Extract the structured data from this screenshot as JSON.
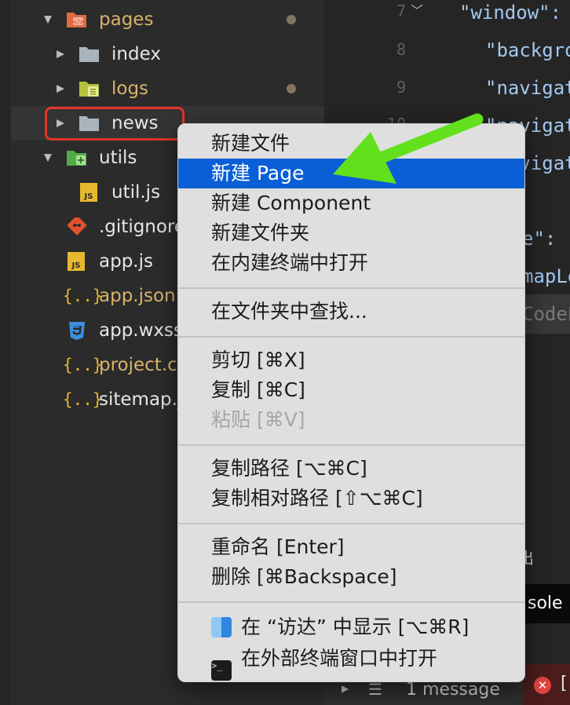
{
  "explorer": {
    "items": [
      {
        "label": "pages",
        "type": "folder-open",
        "color": "#e06a43"
      },
      {
        "label": "index",
        "type": "folder"
      },
      {
        "label": "logs",
        "type": "folder-logs"
      },
      {
        "label": "news",
        "type": "folder"
      },
      {
        "label": "utils",
        "type": "folder-open-utils"
      },
      {
        "label": "util.js",
        "type": "js"
      },
      {
        "label": ".gitignore",
        "type": "git"
      },
      {
        "label": "app.js",
        "type": "js"
      },
      {
        "label": "app.json",
        "type": "json"
      },
      {
        "label": "app.wxss",
        "type": "css"
      },
      {
        "label": "project.c",
        "type": "json"
      },
      {
        "label": "sitemap.j",
        "type": "json"
      }
    ]
  },
  "editor": {
    "line_numbers": [
      "7",
      "8",
      "9",
      "10"
    ],
    "lines": [
      "\"window\": {",
      "\"backgro",
      "\"navigat",
      "\"navigat",
      "\"navigat",
      "e\": \"",
      "mapLo",
      "CodeL"
    ]
  },
  "bottom": {
    "panel_tab": "出",
    "console_tab": "sole",
    "message": "1 message",
    "error_bracket": "["
  },
  "context_menu": {
    "groups": [
      [
        "新建文件",
        "新建 Page",
        "新建 Component",
        "新建文件夹",
        "在内建终端中打开"
      ],
      [
        "在文件夹中查找..."
      ],
      [
        "剪切 [⌘X]",
        "复制 [⌘C]",
        "粘贴 [⌘V]"
      ],
      [
        "复制路径 [⌥⌘C]",
        "复制相对路径 [⇧⌥⌘C]"
      ],
      [
        "重命名 [Enter]",
        "删除 [⌘Backspace]"
      ],
      [
        "在 “访达” 中显示 [⌥⌘R]",
        "在外部终端窗口中打开"
      ]
    ],
    "active_item": "新建 Page",
    "disabled_item": "粘贴 [⌘V]"
  },
  "colors": {
    "highlight_box": "#e5332a",
    "arrow": "#62e01c",
    "menu_active": "#0a5fd6"
  }
}
